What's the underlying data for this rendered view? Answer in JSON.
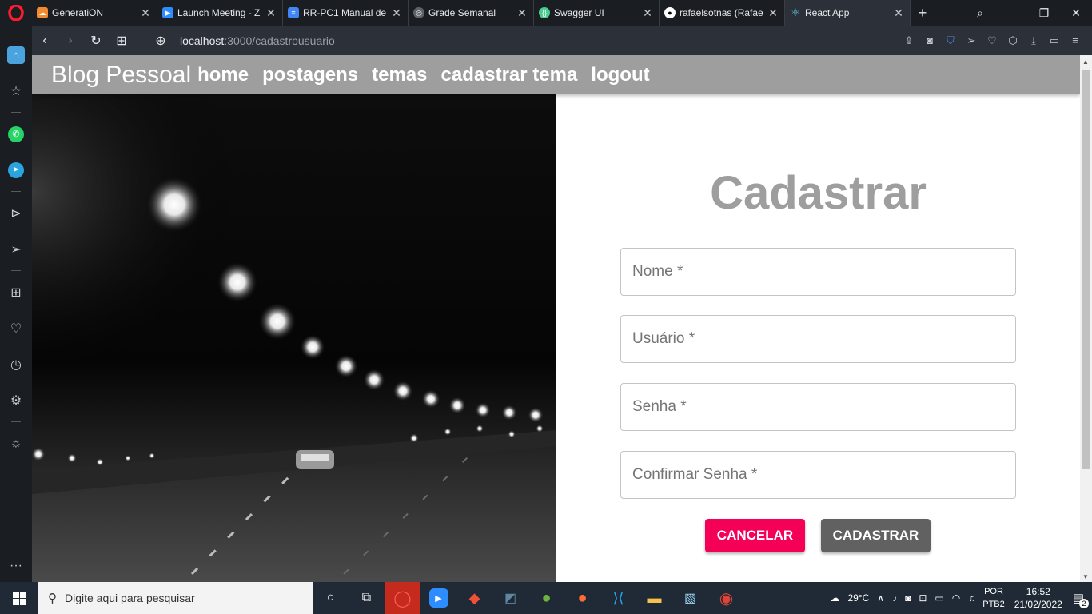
{
  "browser": {
    "tabs": [
      {
        "title": "GeneratiON",
        "icon": "cloud-icon",
        "color": "#f28b30"
      },
      {
        "title": "Launch Meeting - Z",
        "icon": "zoom-icon",
        "color": "#2d8cff"
      },
      {
        "title": "RR-PC1 Manual de",
        "icon": "docs-icon",
        "color": "#4285f4"
      },
      {
        "title": "Grade Semanal",
        "icon": "globe-icon",
        "color": "#9aa0a6"
      },
      {
        "title": "Swagger UI",
        "icon": "swagger-icon",
        "color": "#49cc90"
      },
      {
        "title": "rafaelsotnas (Rafael",
        "icon": "github-icon",
        "color": "#ffffff"
      },
      {
        "title": "React App",
        "icon": "react-icon",
        "color": "#61dafb"
      }
    ],
    "url_host": "localhost",
    "url_rest": ":3000/cadastrousuario"
  },
  "app": {
    "brand": "Blog Pessoal",
    "nav": [
      "home",
      "postagens",
      "temas",
      "cadastrar tema",
      "logout"
    ]
  },
  "form": {
    "title": "Cadastrar",
    "fields": [
      {
        "label": "Nome *",
        "value": ""
      },
      {
        "label": "Usuário *",
        "value": ""
      },
      {
        "label": "Senha *",
        "value": ""
      },
      {
        "label": "Confirmar Senha *",
        "value": ""
      }
    ],
    "cancel_label": "CANCELAR",
    "submit_label": "CADASTRAR",
    "cancel_color": "#f50057",
    "submit_color": "#616161"
  },
  "taskbar": {
    "search_placeholder": "Digite aqui para pesquisar",
    "weather": "29°C",
    "lang_top": "POR",
    "lang_bottom": "PTB2",
    "time": "16:52",
    "date": "21/02/2022",
    "notifications": "2"
  }
}
